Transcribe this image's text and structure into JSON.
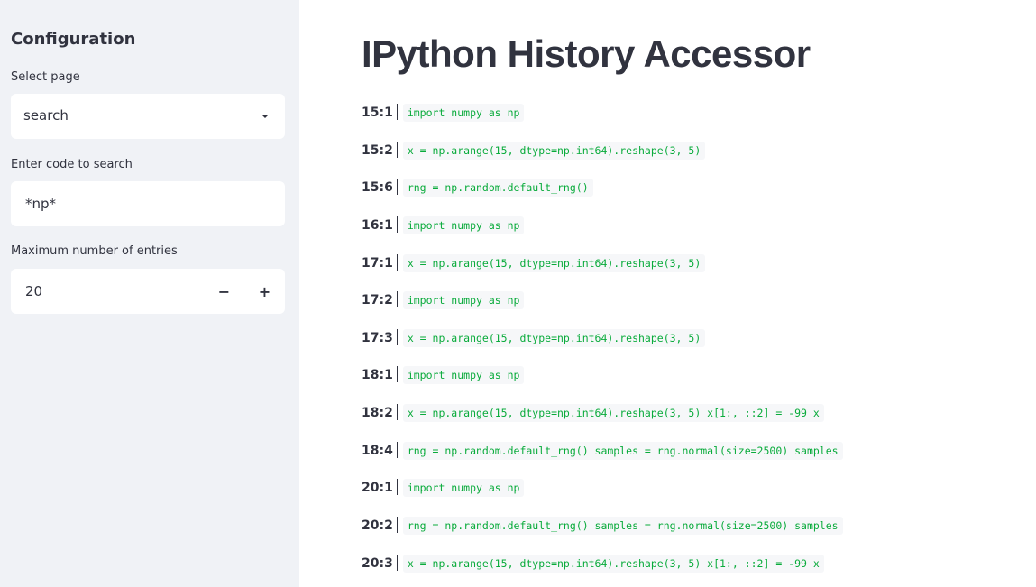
{
  "sidebar": {
    "title": "Configuration",
    "page_select": {
      "label": "Select page",
      "value": "search"
    },
    "search": {
      "label": "Enter code to search",
      "value": "*np*"
    },
    "max_entries": {
      "label": "Maximum number of entries",
      "value": "20",
      "decrement_label": "−",
      "increment_label": "+"
    }
  },
  "main": {
    "title": "IPython History Accessor",
    "history": [
      {
        "id": "15:1",
        "code": "import numpy as np"
      },
      {
        "id": "15:2",
        "code": "x = np.arange(15, dtype=np.int64).reshape(3, 5)"
      },
      {
        "id": "15:6",
        "code": "rng = np.random.default_rng()"
      },
      {
        "id": "16:1",
        "code": "import numpy as np"
      },
      {
        "id": "17:1",
        "code": "x = np.arange(15, dtype=np.int64).reshape(3, 5)"
      },
      {
        "id": "17:2",
        "code": "import numpy as np"
      },
      {
        "id": "17:3",
        "code": "x = np.arange(15, dtype=np.int64).reshape(3, 5)"
      },
      {
        "id": "18:1",
        "code": "import numpy as np"
      },
      {
        "id": "18:2",
        "code": "x = np.arange(15, dtype=np.int64).reshape(3, 5) x[1:, ::2] = -99 x"
      },
      {
        "id": "18:4",
        "code": "rng = np.random.default_rng() samples = rng.normal(size=2500) samples"
      },
      {
        "id": "20:1",
        "code": "import numpy as np"
      },
      {
        "id": "20:2",
        "code": "rng = np.random.default_rng() samples = rng.normal(size=2500) samples"
      },
      {
        "id": "20:3",
        "code": "x = np.arange(15, dtype=np.int64).reshape(3, 5) x[1:, ::2] = -99 x"
      }
    ]
  },
  "colors": {
    "sidebar_bg": "#f0f2f6",
    "text": "#31333f",
    "code_green": "#09ab3b",
    "code_bg": "#f6f7f9"
  }
}
